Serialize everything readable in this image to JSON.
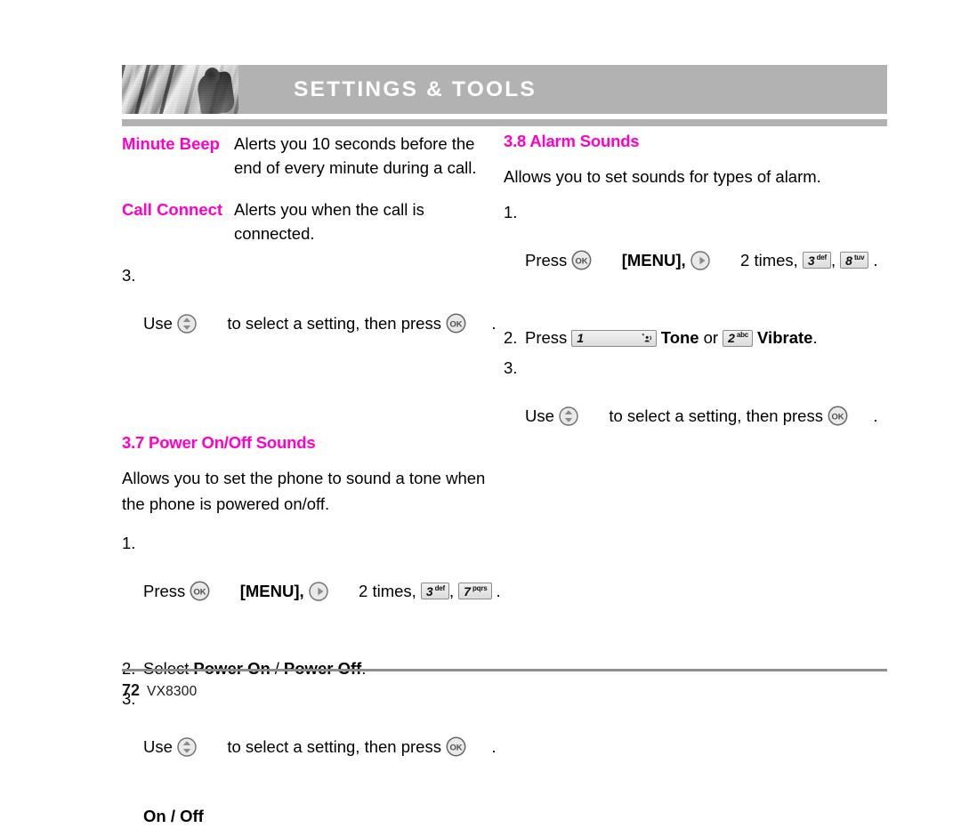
{
  "header": {
    "title": "SETTINGS & TOOLS",
    "photo_alt": "architectural-photo"
  },
  "left_column": {
    "definitions": [
      {
        "term": "Minute Beep",
        "description": "Alerts you 10 seconds before the end of every minute during a call."
      },
      {
        "term": "Call Connect",
        "description": "Alerts you when the call is connected."
      }
    ],
    "step_after_definitions": {
      "number": "3.",
      "text_before_nav": "Use",
      "text_after_nav": "to select a setting, then press",
      "trailing": ".",
      "nav_icon": "updown-navigation-icon",
      "ok_icon": "ok-button-icon"
    },
    "section": {
      "heading": "3.7 Power On/Off Sounds",
      "intro": "Allows you to set the phone to sound a tone when the phone is powered on/off.",
      "steps": [
        {
          "number": "1.",
          "press_label": "Press",
          "ok_icon": "ok-button-icon",
          "menu_label": "[MENU],",
          "right_icon": "right-navigation-icon",
          "times_label": "2 times,",
          "keys": [
            {
              "digit": "3",
              "sub": "def"
            },
            {
              "digit": "7",
              "sub": "pqrs"
            }
          ],
          "separator": ",",
          "trailing": "."
        },
        {
          "number": "2.",
          "select_label": "Select",
          "option_a": "Power On",
          "option_divider": "/",
          "option_b": "Power Off",
          "trailing": "."
        },
        {
          "number": "3.",
          "text_before_nav": "Use",
          "nav_icon": "updown-navigation-icon",
          "text_after_nav": "to select a setting, then press",
          "ok_icon": "ok-button-icon",
          "trailing": ".",
          "sub_note": "On / Off"
        }
      ]
    }
  },
  "right_column": {
    "section": {
      "heading": "3.8 Alarm Sounds",
      "intro": "Allows you to set sounds for types of alarm.",
      "steps": [
        {
          "number": "1.",
          "press_label": "Press",
          "ok_icon": "ok-button-icon",
          "menu_label": "[MENU],",
          "right_icon": "right-navigation-icon",
          "times_label": "2 times,",
          "keys": [
            {
              "digit": "3",
              "sub": "def"
            },
            {
              "digit": "8",
              "sub": "tuv"
            }
          ],
          "separator": ",",
          "trailing": "."
        },
        {
          "number": "2.",
          "press_label": "Press",
          "key_one": {
            "digit": "1",
            "sub": "voicemail-glyph"
          },
          "option_a": "Tone",
          "or_label": "or",
          "key_two": {
            "digit": "2",
            "sub": "abc"
          },
          "option_b": "Vibrate",
          "trailing": "."
        },
        {
          "number": "3.",
          "text_before_nav": "Use",
          "nav_icon": "updown-navigation-icon",
          "text_after_nav": "to select a setting, then press",
          "ok_icon": "ok-button-icon",
          "trailing": "."
        }
      ]
    }
  },
  "footer": {
    "page_number": "72",
    "model": "VX8300"
  },
  "colors": {
    "accent_magenta": "#ff00cc",
    "header_gray": "#b2b2b2",
    "rule_gray": "#8e8e8e",
    "key_face": "#e6e6e6"
  }
}
